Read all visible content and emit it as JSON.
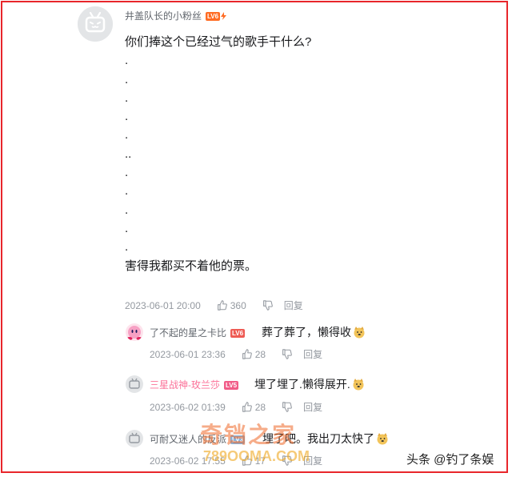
{
  "main_comment": {
    "username": "井盖队长的小粉丝",
    "level": "LV6",
    "lines": [
      "你们捧这个已经过气的歌手干什么?",
      ".",
      ".",
      ".",
      ".",
      ".",
      "..",
      ".",
      ".",
      ".",
      ".",
      ".",
      "害得我都买不着他的票。"
    ],
    "date": "2023-06-01 20:00",
    "likes": "360",
    "reply_label": "回复"
  },
  "replies": [
    {
      "username": "了不起的星之卡比",
      "level": "LV6",
      "text": "葬了葬了，懒得收",
      "date": "2023-06-01 23:36",
      "likes": "28",
      "reply_label": "回复"
    },
    {
      "username": "三星战神-玫兰莎",
      "level": "LV5",
      "text": "埋了埋了.懒得展开.",
      "date": "2023-06-02 01:39",
      "likes": "28",
      "reply_label": "回复"
    },
    {
      "username": "可耐又迷人的反派",
      "level": "LV3",
      "text": "埋了吧。我出刀太快了",
      "date": "2023-06-02 17:55",
      "likes": "17",
      "reply_label": "回复"
    }
  ],
  "watermark": {
    "line1": "奇铛之家",
    "line2": "789OOMA.COM"
  },
  "source": "头条 @钓了条娱",
  "colors": {
    "frame": "#e8262b",
    "level_orange": "#ff6c24",
    "pink_name": "#fb7299"
  }
}
